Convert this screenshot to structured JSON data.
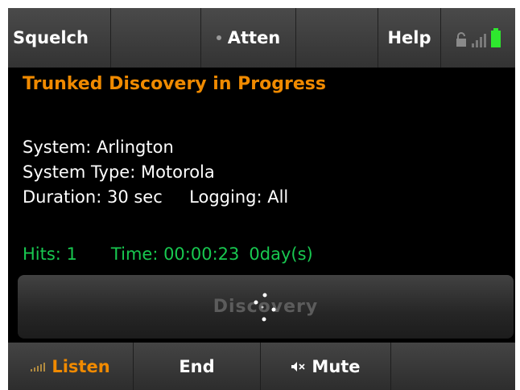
{
  "topbar": {
    "squelch_label": "Squelch",
    "atten_label": "Atten",
    "help_label": "Help",
    "icons": [
      "lock-icon",
      "signal-icon",
      "battery-icon"
    ]
  },
  "status": {
    "heading": "Trunked Discovery in Progress",
    "system": "System: Arlington",
    "system_type": "System Type: Motorola",
    "duration": "Duration: 30 sec",
    "logging": "Logging: All",
    "hits": "Hits: 1",
    "time": "Time: 00:00:23",
    "days": "0day(s)"
  },
  "discovery": {
    "label": "Discovery"
  },
  "bottombar": {
    "listen_label": "Listen",
    "end_label": "End",
    "mute_label": "Mute"
  },
  "colors": {
    "heading": "#f08a00",
    "hits_text": "#18c850",
    "listen_text": "#f08a00",
    "battery": "#2ee82e"
  }
}
